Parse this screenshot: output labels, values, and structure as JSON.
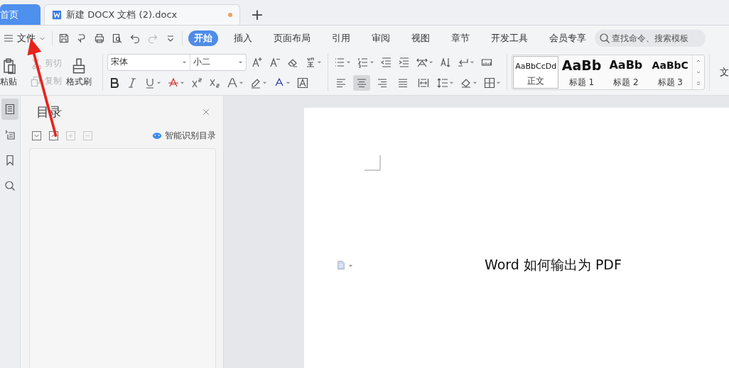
{
  "doc_tabs": [
    {
      "label": "首页",
      "kind": "home",
      "selected": false,
      "unsaved": false
    },
    {
      "label": "新建 DOCX 文档 (2).docx",
      "kind": "document",
      "selected": true,
      "unsaved": true
    }
  ],
  "new_tab": "+",
  "file_menu": "文件",
  "ribbon_tabs": [
    {
      "label": "开始",
      "selected": true
    },
    {
      "label": "插入",
      "selected": false
    },
    {
      "label": "页面布局",
      "selected": false
    },
    {
      "label": "引用",
      "selected": false
    },
    {
      "label": "审阅",
      "selected": false
    },
    {
      "label": "视图",
      "selected": false
    },
    {
      "label": "章节",
      "selected": false
    },
    {
      "label": "开发工具",
      "selected": false
    },
    {
      "label": "会员专享",
      "selected": false
    }
  ],
  "search": {
    "placeholder": "查找命令、搜索模板"
  },
  "clipboard": {
    "paste": "粘贴",
    "cut": {
      "label": "剪切",
      "disabled": true
    },
    "copy": {
      "label": "复制",
      "disabled": true
    },
    "format_painter": "格式刷"
  },
  "font": {
    "name": "宋体",
    "size": "小二"
  },
  "align_buttons": [
    {
      "selected": false
    },
    {
      "selected": true
    },
    {
      "selected": false
    },
    {
      "selected": false
    },
    {
      "selected": false
    }
  ],
  "styles": [
    {
      "preview": "AaBbCcDd",
      "label": "正文",
      "kind": "body",
      "selected": true
    },
    {
      "preview": "AaBb",
      "label": "标题 1",
      "kind": "heading1",
      "selected": false
    },
    {
      "preview": "AaBb",
      "label": "标题 2",
      "kind": "heading2",
      "selected": false
    },
    {
      "preview": "AaBbC",
      "label": "标题 3",
      "kind": "heading3",
      "selected": false
    }
  ],
  "ribbon_overflow": "文",
  "sidebar_rail": [
    {
      "kind": "toc",
      "selected": true
    },
    {
      "kind": "nav",
      "selected": false
    },
    {
      "kind": "bookmark",
      "selected": false
    },
    {
      "kind": "search",
      "selected": false
    }
  ],
  "toc_panel": {
    "title": "目录",
    "smart_button": "智能识别目录",
    "tools": [
      {
        "kind": "expand",
        "disabled": false
      },
      {
        "kind": "collapse",
        "disabled": false
      },
      {
        "kind": "add",
        "disabled": true
      },
      {
        "kind": "remove",
        "disabled": true
      }
    ]
  },
  "document": {
    "text": "Word 如何输出为 PDF"
  }
}
